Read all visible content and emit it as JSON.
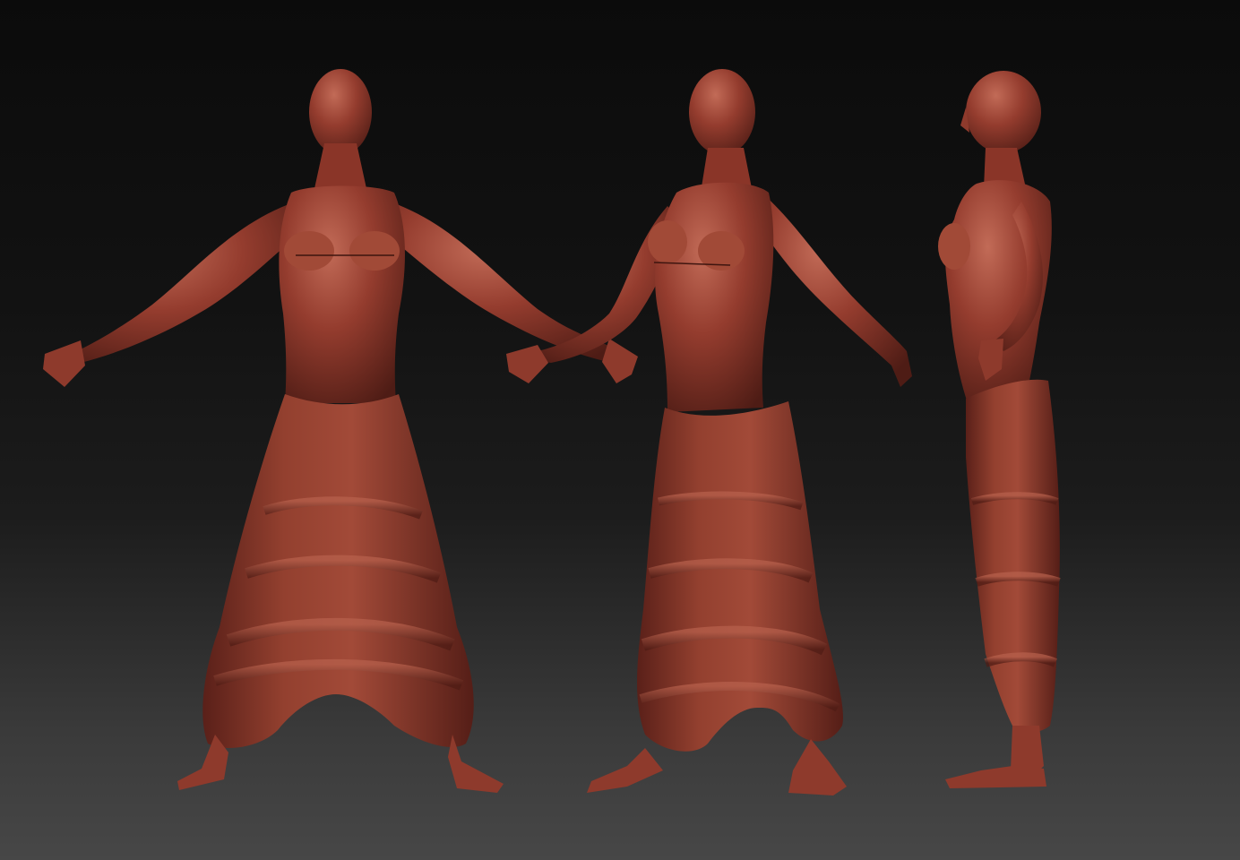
{
  "scene": {
    "background_top": "#0b0b0b",
    "background_bottom": "#474747",
    "material_color": "#8a3428",
    "material_highlight": "#c06a58",
    "material_shadow": "#4a1a14"
  },
  "views": [
    {
      "id": "front",
      "name": "front-view-figure"
    },
    {
      "id": "three-quarter",
      "name": "three-quarter-view-figure"
    },
    {
      "id": "side",
      "name": "side-view-figure"
    }
  ]
}
